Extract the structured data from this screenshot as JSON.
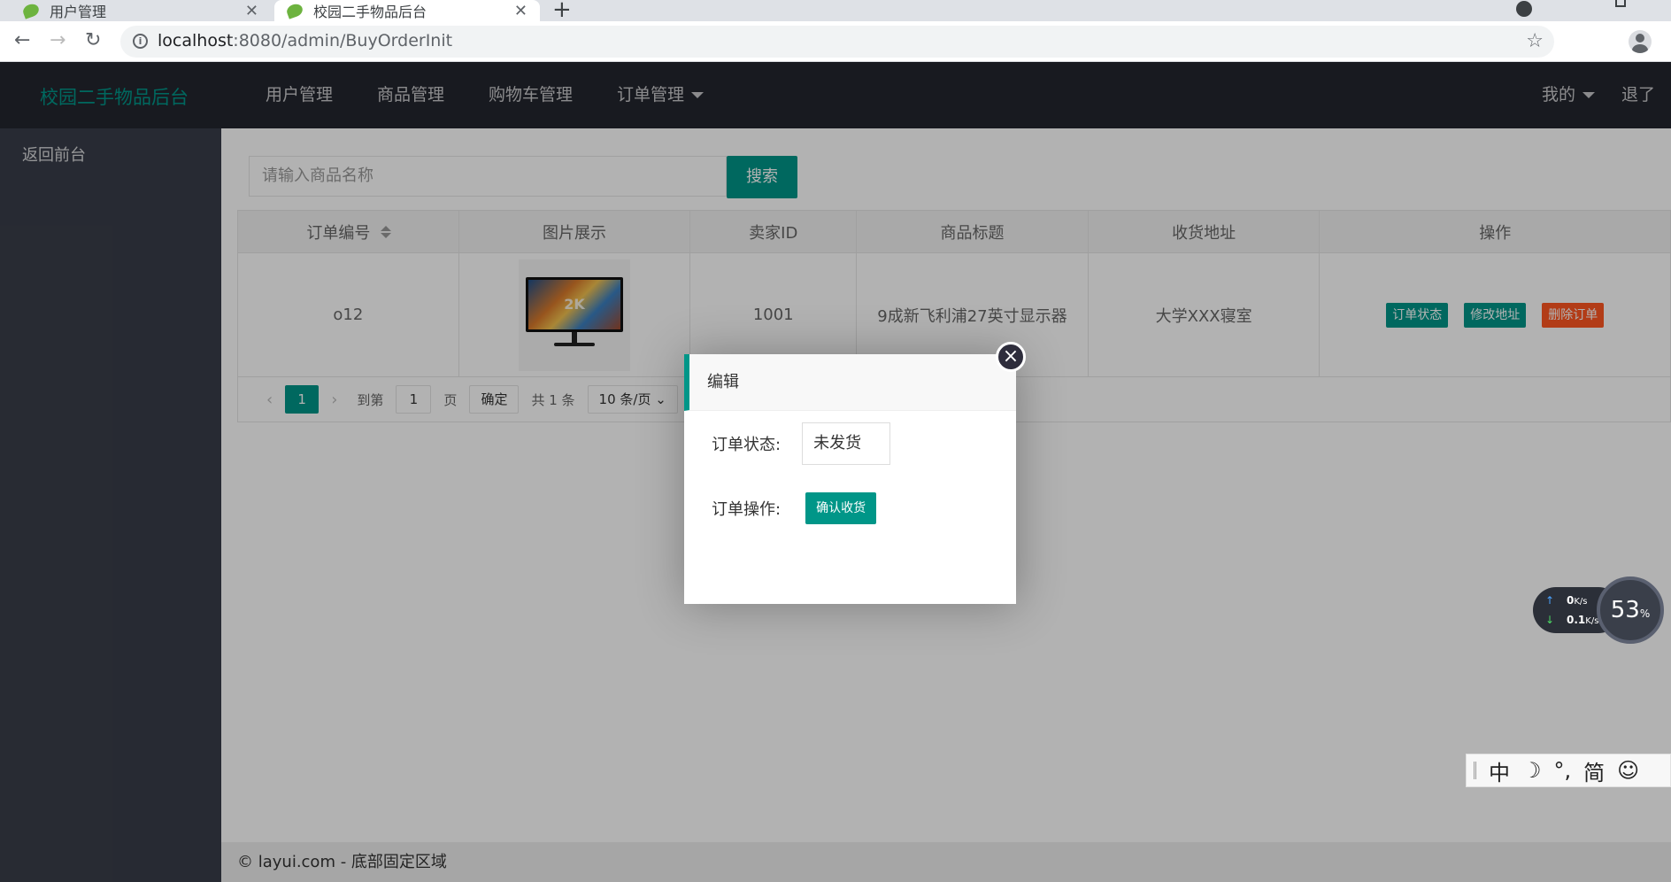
{
  "browser": {
    "tabs": [
      {
        "title": "用户管理"
      },
      {
        "title": "校园二手物品后台"
      }
    ],
    "url_host": "localhost",
    "url_rest": ":8080/admin/BuyOrderInit"
  },
  "header": {
    "logo": "校园二手物品后台",
    "nav": [
      "用户管理",
      "商品管理",
      "购物车管理",
      "订单管理"
    ],
    "right": [
      "我的",
      "退了"
    ]
  },
  "sidebar": {
    "items": [
      "返回前台"
    ]
  },
  "search": {
    "placeholder": "请输入商品名称",
    "button": "搜索"
  },
  "table": {
    "headers": [
      "订单编号",
      "图片展示",
      "卖家ID",
      "商品标题",
      "收货地址",
      "操作"
    ],
    "rows": [
      {
        "order_id": "o12",
        "image_label": "2K",
        "seller_id": "1001",
        "title": "9成新飞利浦27英寸显示器",
        "address": "大学XXX寝室",
        "actions": [
          "订单状态",
          "修改地址",
          "删除订单"
        ]
      }
    ]
  },
  "pager": {
    "current": "1",
    "goto_label": "到第",
    "goto_value": "1",
    "page_unit": "页",
    "confirm": "确定",
    "total": "共 1 条",
    "per_page": "10 条/页"
  },
  "footer": {
    "text": "© layui.com - 底部固定区域"
  },
  "modal": {
    "title": "编辑",
    "status_label": "订单状态:",
    "status_value": "未发货",
    "op_label": "订单操作:",
    "op_button": "确认收货"
  },
  "netmon": {
    "up": "0",
    "down": "0.1",
    "unit": "K/s",
    "percent": "53",
    "percent_unit": "%"
  },
  "ime": [
    "中",
    "☽",
    "°,",
    "简",
    "☺"
  ],
  "colors": {
    "accent": "#009688",
    "danger": "#ff5722",
    "header_bg": "#23262e",
    "sidebar_bg": "#393d49"
  }
}
